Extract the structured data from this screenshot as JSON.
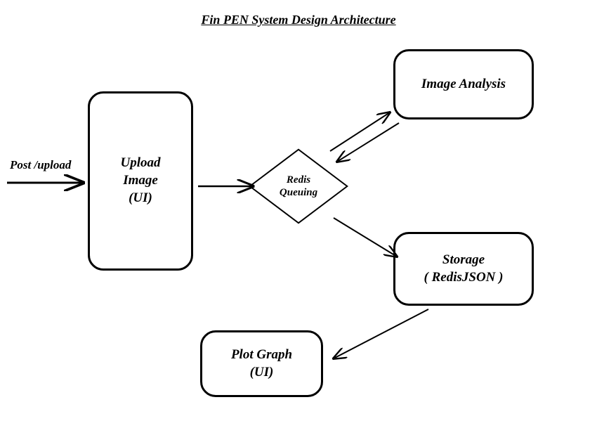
{
  "title": "Fin PEN System Design Architecture",
  "entry_label": "Post /upload",
  "nodes": {
    "upload": {
      "line1": "Upload",
      "line2": "Image",
      "line3": "(UI)"
    },
    "redis": {
      "line1": "Redis",
      "line2": "Queuing"
    },
    "analysis": {
      "line1": "Image Analysis"
    },
    "storage": {
      "line1": "Storage",
      "line2": "( RedisJSON )"
    },
    "plot": {
      "line1": "Plot Graph",
      "line2": "(UI)"
    }
  }
}
